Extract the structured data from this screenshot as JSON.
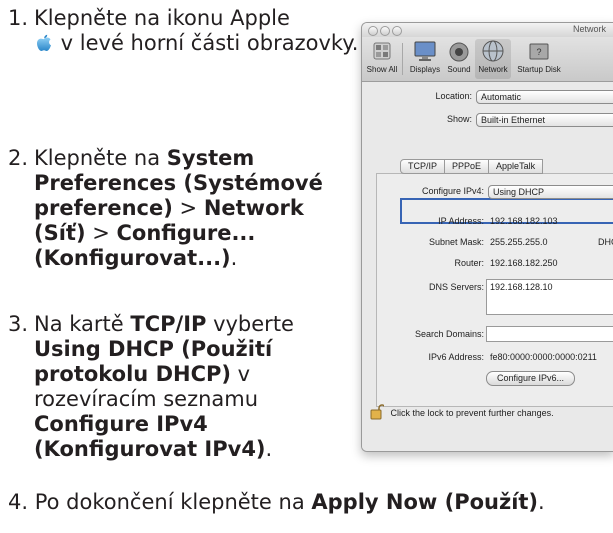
{
  "instructions": {
    "step1": {
      "num": "1.",
      "a": "Klepněte na ikonu Apple",
      "b": " v levé horní části obrazovky."
    },
    "step2": {
      "num": "2.",
      "a": "Klepněte na ",
      "b": "System Preferences (Systémové preference)",
      "c": " > ",
      "d": "Network (Síť)",
      "e": " > ",
      "f": "Configure... (Konfigurovat...)",
      "g": "."
    },
    "step3": {
      "num": "3.",
      "a": "Na kartě ",
      "b": "TCP/IP",
      "c": " vyberte ",
      "d": "Using DHCP (Použití protokolu DHCP)",
      "e": " v rozevíracím seznamu ",
      "f": "Configure IPv4 (Konfigurovat IPv4)",
      "g": "."
    },
    "step4": {
      "num": "4.",
      "a": "Po dokončení klepněte na ",
      "b": "Apply Now (Použít)",
      "c": "."
    }
  },
  "window": {
    "title": "Network",
    "toolbar": [
      "Show All",
      "Displays",
      "Sound",
      "Network",
      "Startup Disk"
    ],
    "location_label": "Location:",
    "location_value": "Automatic",
    "show_label": "Show:",
    "show_value": "Built-in Ethernet",
    "tabs": [
      "TCP/IP",
      "PPPoE",
      "AppleTalk"
    ],
    "configure_label": "Configure IPv4:",
    "configure_value": "Using DHCP",
    "ip_label": "IP Address:",
    "ip_value": "192.168.182.103",
    "subnet_label": "Subnet Mask:",
    "subnet_value": "255.255.255.0",
    "subnet_extra": "DHC",
    "router_label": "Router:",
    "router_value": "192.168.182.250",
    "dns_label": "DNS Servers:",
    "dns_value": "192.168.128.10",
    "search_label": "Search Domains:",
    "ipv6_label": "IPv6 Address:",
    "ipv6_value": "fe80:0000:0000:0000:0211",
    "ipv6_button": "Configure IPv6...",
    "lock_text": "Click the lock to prevent further changes."
  },
  "colors": {
    "highlight": "#3764b4"
  }
}
